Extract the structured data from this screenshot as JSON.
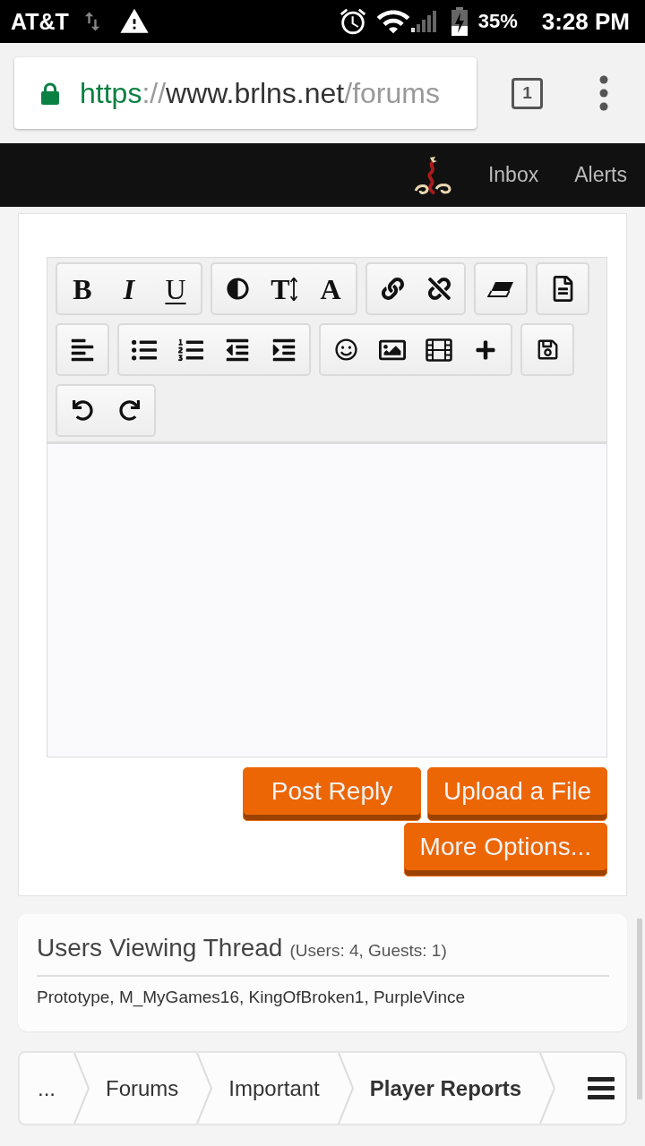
{
  "status_bar": {
    "carrier": "AT&T",
    "battery": "35%",
    "time": "3:28 PM"
  },
  "browser": {
    "url": {
      "scheme": "https",
      "separator": "://",
      "host": "www.brlns.net",
      "path": "/forums"
    },
    "tab_count": "1"
  },
  "site_nav": {
    "links": [
      "Inbox",
      "Alerts"
    ]
  },
  "editor": {
    "toolbar": [
      [
        [
          {
            "kind": "bold",
            "label": "B"
          },
          {
            "kind": "italic",
            "label": "I"
          },
          {
            "kind": "underline",
            "label": "U"
          }
        ],
        [
          {
            "kind": "color"
          },
          {
            "kind": "size",
            "label": "T"
          },
          {
            "kind": "font",
            "label": "A"
          }
        ],
        [
          {
            "kind": "link"
          },
          {
            "kind": "unlink"
          }
        ],
        [
          {
            "kind": "removeformat"
          }
        ],
        [
          {
            "kind": "bbcode"
          }
        ]
      ],
      [
        [
          {
            "kind": "align"
          }
        ],
        [
          {
            "kind": "bulletlist"
          },
          {
            "kind": "numberlist"
          },
          {
            "kind": "outdent"
          },
          {
            "kind": "indent"
          }
        ],
        [
          {
            "kind": "smilies"
          },
          {
            "kind": "image"
          },
          {
            "kind": "media"
          },
          {
            "kind": "insert"
          }
        ],
        [
          {
            "kind": "drafts"
          }
        ]
      ],
      [
        [
          {
            "kind": "undo"
          },
          {
            "kind": "redo"
          }
        ]
      ]
    ],
    "actions": [
      "Post Reply",
      "Upload a File",
      "More Options..."
    ]
  },
  "users_viewing": {
    "title": "Users Viewing Thread",
    "counts": "(Users: 4, Guests: 1)",
    "names": "Prototype, M_MyGames16, KingOfBroken1, PurpleVince"
  },
  "breadcrumb": [
    {
      "label": "...",
      "selected": false
    },
    {
      "label": "Forums",
      "selected": false
    },
    {
      "label": "Important",
      "selected": false
    },
    {
      "label": "Player Reports",
      "selected": true
    }
  ]
}
